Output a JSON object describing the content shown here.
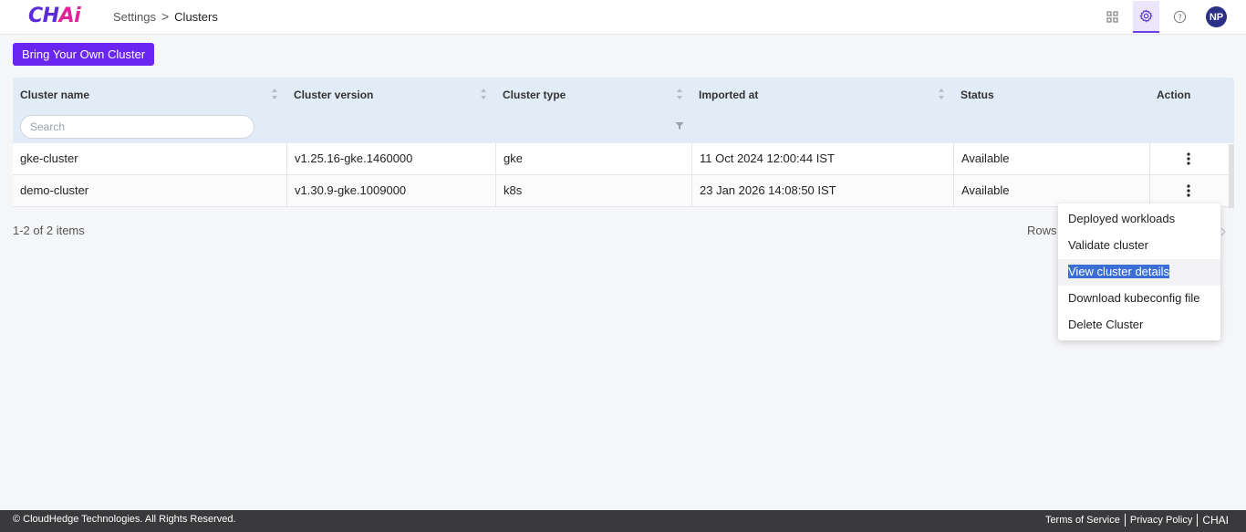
{
  "app": {
    "logo_main": "CH",
    "logo_accent": "Ai"
  },
  "breadcrumb": {
    "parent": "Settings",
    "separator": ">",
    "current": "Clusters"
  },
  "user": {
    "initials": "NP"
  },
  "icons": {
    "apps": "grid-icon",
    "settings": "gear-icon",
    "help": "help-icon",
    "sort": "sort-icon",
    "filter": "filter-icon",
    "more": "kebab-icon"
  },
  "actions": {
    "byoc_label": "Bring Your Own Cluster"
  },
  "table": {
    "columns": [
      "Cluster name",
      "Cluster version",
      "Cluster type",
      "Imported at",
      "Status",
      "Action"
    ],
    "search_placeholder": "Search",
    "rows": [
      {
        "name": "gke-cluster",
        "version": "v1.25.16-gke.1460000",
        "type": "gke",
        "imported": "11 Oct 2024 12:00:44 IST",
        "status": "Available"
      },
      {
        "name": "demo-cluster",
        "version": "v1.30.9-gke.1009000",
        "type": "k8s",
        "imported": "23 Jan 2026 14:08:50 IST",
        "status": "Available"
      }
    ]
  },
  "pagination": {
    "summary": "1-2 of 2 items",
    "rows_label": "Rows"
  },
  "context_menu": {
    "items": [
      "Deployed workloads",
      "Validate cluster",
      "View cluster details",
      "Download kubeconfig file",
      "Delete Cluster"
    ],
    "highlighted": "View cluster details"
  },
  "footer": {
    "copyright": "© CloudHedge Technologies. All Rights Reserved.",
    "terms": "Terms of Service",
    "privacy": "Privacy Policy",
    "brand": "CHAI"
  },
  "colors": {
    "accent": "#6a26f0",
    "header_bg": "#e2ecf6",
    "avatar": "#2b2f86",
    "footer_bg": "#3a3a3d"
  }
}
